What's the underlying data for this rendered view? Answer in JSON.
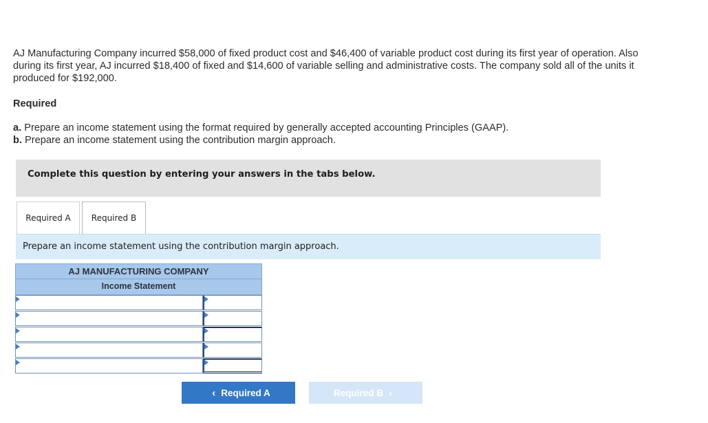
{
  "problem": {
    "text": "AJ Manufacturing Company incurred $58,000 of fixed product cost and $46,400 of variable product cost during its first year of operation. Also during its first year, AJ incurred $18,400 of fixed and $14,600 of variable selling and administrative costs. The company sold all of the units it produced for $192,000."
  },
  "required": {
    "heading": "Required",
    "a_marker": "a.",
    "a_text": "Prepare an income statement using the format required by generally accepted accounting Principles (GAAP).",
    "b_marker": "b.",
    "b_text": "Prepare an income statement using the contribution margin approach."
  },
  "banner": {
    "text": "Complete this question by entering your answers in the tabs below."
  },
  "tabs": [
    {
      "label": "Required A"
    },
    {
      "label": "Required B"
    }
  ],
  "instruction": {
    "text": "Prepare an income statement using the contribution margin approach."
  },
  "statement": {
    "company": "AJ MANUFACTURING COMPANY",
    "title": "Income Statement",
    "rows": [
      {
        "label": "",
        "value": ""
      },
      {
        "label": "",
        "value": ""
      },
      {
        "label": "",
        "value": ""
      },
      {
        "label": "",
        "value": ""
      },
      {
        "label": "",
        "value": ""
      }
    ]
  },
  "navigation": {
    "prev_label": "Required A",
    "next_label": "Required B",
    "prev_icon": "chevron-left-icon",
    "next_icon": "chevron-right-icon",
    "prev_color": "#3378c6",
    "next_color": "#d4e6f8"
  }
}
